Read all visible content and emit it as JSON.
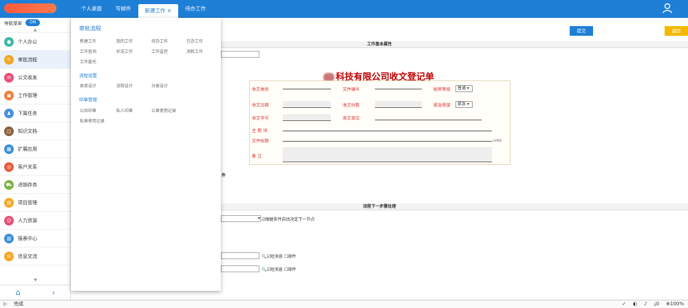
{
  "topbar": {
    "logo_text": "",
    "tabs": [
      {
        "label": "个人桌面"
      },
      {
        "label": "写邮件"
      },
      {
        "label": "新建工作 ×"
      },
      {
        "label": "待办工作"
      }
    ]
  },
  "sidebar": {
    "nav_toggle_label": "导航菜单",
    "toggle_state": "ON",
    "items": [
      {
        "label": "个人办公",
        "icon": "person-icon",
        "color": "#3db8a8"
      },
      {
        "label": "审批流程",
        "icon": "approval-icon",
        "color": "#f5a623"
      },
      {
        "label": "公文收发",
        "icon": "document-icon",
        "color": "#e94e77"
      },
      {
        "label": "工作管理",
        "icon": "work-icon",
        "color": "#f07c3c"
      },
      {
        "label": "下属任务",
        "icon": "team-icon",
        "color": "#4a90e2"
      },
      {
        "label": "知识文档",
        "icon": "knowledge-icon",
        "color": "#8b5e3c"
      },
      {
        "label": "扩展应用",
        "icon": "apps-icon",
        "color": "#3b8fd6"
      },
      {
        "label": "客户关系",
        "icon": "crm-icon",
        "color": "#e85b3c"
      },
      {
        "label": "进销存务",
        "icon": "inventory-icon",
        "color": "#7cb342"
      },
      {
        "label": "项目管理",
        "icon": "project-icon",
        "color": "#f5a623"
      },
      {
        "label": "人力资源",
        "icon": "hr-icon",
        "color": "#e94e77"
      },
      {
        "label": "报表中心",
        "icon": "report-icon",
        "color": "#3b8fd6"
      },
      {
        "label": "信息交流",
        "icon": "chat-icon",
        "color": "#f5a623"
      }
    ]
  },
  "main": {
    "submit_label": "提交",
    "return_label": "返回",
    "work_basic_header": "工作基本属性",
    "doc_title_suffix": "科技有限公司收文登记单",
    "form": {
      "receive_type_label": "收文类别",
      "doc_number_label": "文件编号",
      "secret_level_label": "秘密等级",
      "secret_level_value": "普通",
      "receive_date_label": "收文日期",
      "receive_count_label": "收文份数",
      "urgency_label": "紧急程度",
      "urgency_value": "紧急",
      "receive_no_label": "收文字号",
      "sender_unit_label": "来文单位",
      "subject_label": "主 题 词",
      "doc_title_label": "文件标题",
      "note_label": "备    注",
      "img_alt": "res"
    },
    "attachment_label": "件",
    "next_step_header": "流程下一步骤处理",
    "auto_decide_label": "根据条件自动决定下一节点",
    "sms_label_1": "短消息",
    "mail_label_1": "邮件",
    "sms_label_2": "短消息",
    "mail_label_2": "邮件"
  },
  "dropdown": {
    "section1_title": "审批流程",
    "section1_items": [
      "新建工作",
      "我的工作",
      "待办工作",
      "已办工作",
      "工作查询",
      "抄送工作",
      "工作监控",
      "消耗工作",
      "工作委托"
    ],
    "section2_title": "流程设置",
    "section2_items": [
      "表单设计",
      "流程设计",
      "分类设计"
    ],
    "section3_title": "印章管理",
    "section3_items": [
      "公共印章",
      "私人印章",
      "公章使用记录",
      "私章使用记录"
    ]
  },
  "statusbar": {
    "text": "完成",
    "zoom": "100%",
    "count": "0"
  }
}
